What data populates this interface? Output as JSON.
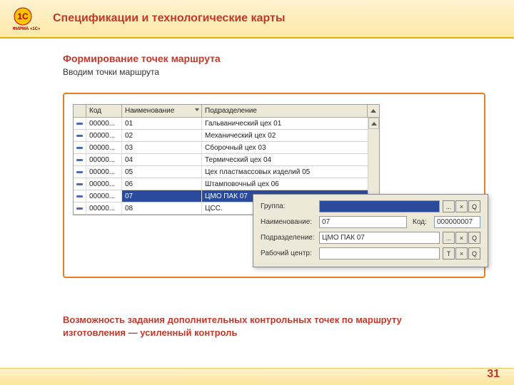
{
  "header": {
    "title": "Спецификации и технологические карты"
  },
  "section": {
    "subtitle": "Формирование точек маршрута",
    "subtext": "Вводим точки маршрута"
  },
  "table": {
    "cols": {
      "code": "Код",
      "name": "Наименование",
      "dept": "Подразделение"
    },
    "rows": [
      {
        "code": "00000...",
        "name": "01",
        "dept": "Гальванический цех 01",
        "sel": false
      },
      {
        "code": "00000...",
        "name": "02",
        "dept": "Механический цех 02",
        "sel": false
      },
      {
        "code": "00000...",
        "name": "03",
        "dept": "Сборочный цех 03",
        "sel": false
      },
      {
        "code": "00000...",
        "name": "04",
        "dept": "Термический цех 04",
        "sel": false
      },
      {
        "code": "00000...",
        "name": "05",
        "dept": "Цех пластмассовых изделий 05",
        "sel": false
      },
      {
        "code": "00000...",
        "name": "06",
        "dept": "Штамповочный цех 06",
        "sel": false
      },
      {
        "code": "00000...",
        "name": "07",
        "dept": "ЦМО ПАК 07",
        "sel": true
      },
      {
        "code": "00000...",
        "name": "08",
        "dept": "ЦСС.",
        "sel": false
      }
    ]
  },
  "form": {
    "labels": {
      "group": "Группа:",
      "name": "Наименование:",
      "dept": "Подразделение:",
      "center": "Рабочий центр:",
      "code": "Код:"
    },
    "values": {
      "group": "",
      "name": "07",
      "dept": "ЦМО ПАК 07",
      "center": "",
      "code": "000000007"
    },
    "buttons": {
      "dots": "...",
      "x": "×",
      "q": "Q",
      "t": "T"
    }
  },
  "footer": {
    "note": "Возможность задания дополнительных контрольных точек по маршруту изготовления — усиленный контроль",
    "page": "31"
  }
}
